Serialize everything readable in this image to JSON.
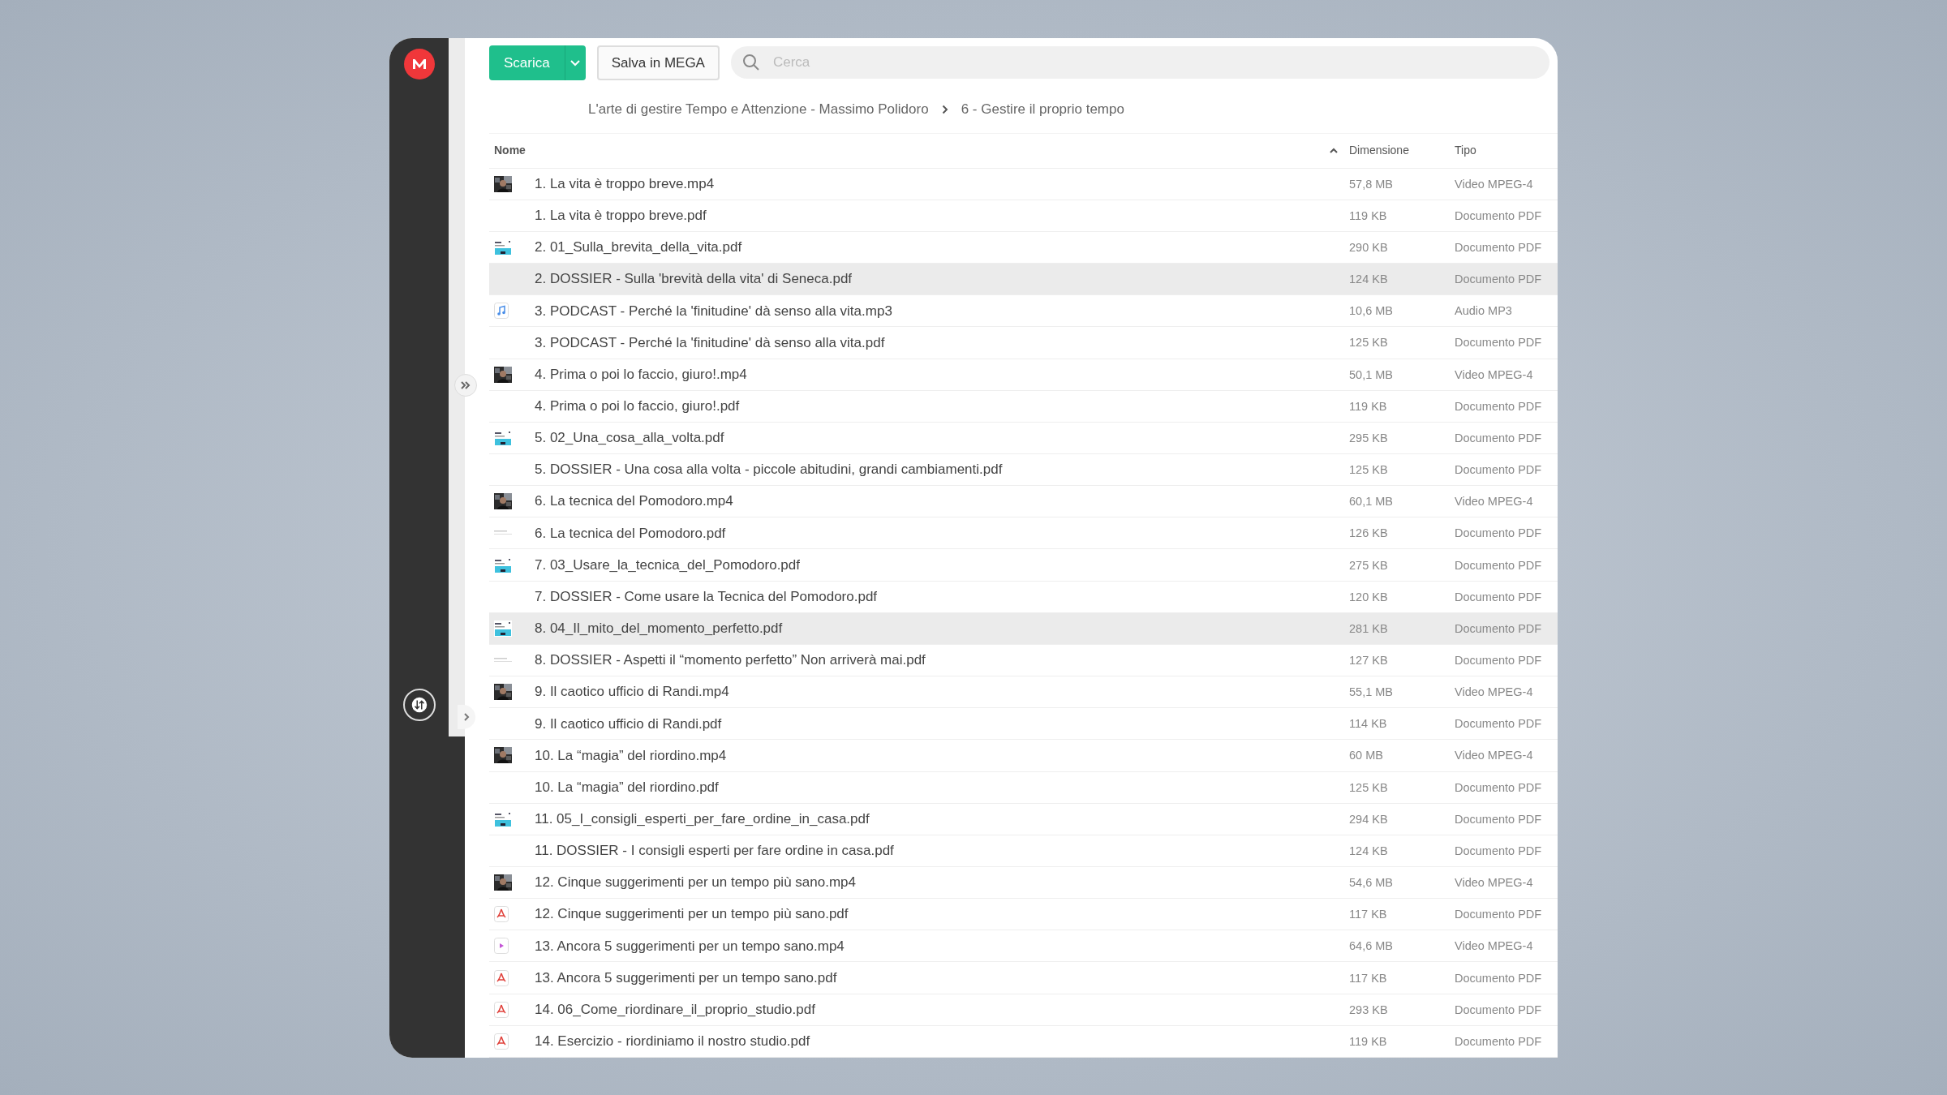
{
  "toolbar": {
    "download_button": "Scarica",
    "save_button": "Salva in MEGA",
    "search": {
      "placeholder": "Cerca"
    }
  },
  "breadcrumb": [
    "L'arte di gestire Tempo e Attenzione - Massimo Polidoro",
    "6 - Gestire il proprio tempo"
  ],
  "table": {
    "columns": [
      {
        "label": "Nome",
        "sorted": true
      },
      {
        "label": "Dimensione",
        "sorted": false
      },
      {
        "label": "Tipo",
        "sorted": false
      }
    ],
    "rows": [
      {
        "kind": "video-thumb",
        "name": "1. La vita è troppo breve.mp4",
        "size": "57,8 MB",
        "type": "Video MPEG-4",
        "highlighted": false
      },
      {
        "kind": "none",
        "name": "1. La vita è troppo breve.pdf",
        "size": "119 KB",
        "type": "Documento PDF",
        "highlighted": false
      },
      {
        "kind": "doc-thumb",
        "name": "2. 01_Sulla_brevita_della_vita.pdf",
        "size": "290 KB",
        "type": "Documento PDF",
        "highlighted": false
      },
      {
        "kind": "none",
        "name": "2. DOSSIER - Sulla 'brevità della vita' di Seneca.pdf",
        "size": "124 KB",
        "type": "Documento PDF",
        "highlighted": true
      },
      {
        "kind": "audio",
        "name": "3. PODCAST - Perché la 'finitudine' dà senso alla vita.mp3",
        "size": "10,6 MB",
        "type": "Audio MP3",
        "highlighted": false
      },
      {
        "kind": "none",
        "name": "3. PODCAST - Perché la 'finitudine' dà senso alla vita.pdf",
        "size": "125 KB",
        "type": "Documento PDF",
        "highlighted": false
      },
      {
        "kind": "video-thumb",
        "name": "4. Prima o poi lo faccio, giuro!.mp4",
        "size": "50,1 MB",
        "type": "Video MPEG-4",
        "highlighted": false
      },
      {
        "kind": "none",
        "name": "4. Prima o poi lo faccio, giuro!.pdf",
        "size": "119 KB",
        "type": "Documento PDF",
        "highlighted": false
      },
      {
        "kind": "doc-thumb",
        "name": "5. 02_Una_cosa_alla_volta.pdf",
        "size": "295 KB",
        "type": "Documento PDF",
        "highlighted": false
      },
      {
        "kind": "none",
        "name": "5. DOSSIER - Una cosa alla volta - piccole abitudini, grandi cambiamenti.pdf",
        "size": "125 KB",
        "type": "Documento PDF",
        "highlighted": false
      },
      {
        "kind": "video-thumb",
        "name": "6. La tecnica del Pomodoro.mp4",
        "size": "60,1 MB",
        "type": "Video MPEG-4",
        "highlighted": false
      },
      {
        "kind": "lines-thumb",
        "name": "6. La tecnica del Pomodoro.pdf",
        "size": "126 KB",
        "type": "Documento PDF",
        "highlighted": false
      },
      {
        "kind": "doc-thumb",
        "name": "7. 03_Usare_la_tecnica_del_Pomodoro.pdf",
        "size": "275 KB",
        "type": "Documento PDF",
        "highlighted": false
      },
      {
        "kind": "none",
        "name": "7. DOSSIER - Come usare la Tecnica del Pomodoro.pdf",
        "size": "120 KB",
        "type": "Documento PDF",
        "highlighted": false
      },
      {
        "kind": "doc-thumb",
        "name": "8. 04_Il_mito_del_momento_perfetto.pdf",
        "size": "281 KB",
        "type": "Documento PDF",
        "highlighted": true
      },
      {
        "kind": "lines-thumb",
        "name": "8. DOSSIER - Aspetti il “momento perfetto” Non arriverà mai.pdf",
        "size": "127 KB",
        "type": "Documento PDF",
        "highlighted": false
      },
      {
        "kind": "video-thumb",
        "name": "9. Il caotico ufficio di Randi.mp4",
        "size": "55,1 MB",
        "type": "Video MPEG-4",
        "highlighted": false
      },
      {
        "kind": "none",
        "name": "9. Il caotico ufficio di Randi.pdf",
        "size": "114 KB",
        "type": "Documento PDF",
        "highlighted": false
      },
      {
        "kind": "video-thumb",
        "name": "10. La “magia” del riordino.mp4",
        "size": "60 MB",
        "type": "Video MPEG-4",
        "highlighted": false
      },
      {
        "kind": "none",
        "name": "10. La “magia” del riordino.pdf",
        "size": "125 KB",
        "type": "Documento PDF",
        "highlighted": false
      },
      {
        "kind": "doc-thumb",
        "name": "11. 05_I_consigli_esperti_per_fare_ordine_in_casa.pdf",
        "size": "294 KB",
        "type": "Documento PDF",
        "highlighted": false
      },
      {
        "kind": "none",
        "name": "11. DOSSIER - I consigli esperti per fare ordine in casa.pdf",
        "size": "124 KB",
        "type": "Documento PDF",
        "highlighted": false
      },
      {
        "kind": "video-thumb",
        "name": "12. Cinque suggerimenti per un tempo più sano.mp4",
        "size": "54,6 MB",
        "type": "Video MPEG-4",
        "highlighted": false
      },
      {
        "kind": "pdf",
        "name": "12. Cinque suggerimenti per un tempo più sano.pdf",
        "size": "117 KB",
        "type": "Documento PDF",
        "highlighted": false
      },
      {
        "kind": "video",
        "name": "13. Ancora 5 suggerimenti per un tempo sano.mp4",
        "size": "64,6 MB",
        "type": "Video MPEG-4",
        "highlighted": false
      },
      {
        "kind": "pdf",
        "name": "13. Ancora 5 suggerimenti per un tempo sano.pdf",
        "size": "117 KB",
        "type": "Documento PDF",
        "highlighted": false
      },
      {
        "kind": "pdf",
        "name": "14. 06_Come_riordinare_il_proprio_studio.pdf",
        "size": "293 KB",
        "type": "Documento PDF",
        "highlighted": false
      },
      {
        "kind": "pdf",
        "name": "14. Esercizio - riordiniamo il nostro studio.pdf",
        "size": "119 KB",
        "type": "Documento PDF",
        "highlighted": false
      }
    ]
  }
}
